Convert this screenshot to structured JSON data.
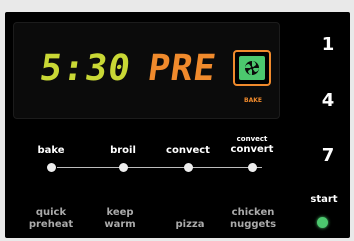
{
  "display": {
    "time": "5:30",
    "mode": "PRE",
    "indicator_label": "BAKE",
    "icon": "convection-fan-icon"
  },
  "keypad": {
    "k1": "1",
    "k4": "4",
    "k7": "7",
    "start_label": "start"
  },
  "modes": {
    "bake": "bake",
    "broil": "broil",
    "convect": "convect",
    "convect_convert_top": "convect",
    "convect_convert_bottom": "convert"
  },
  "options": {
    "quick_1": "quick",
    "quick_2": "preheat",
    "keep_1": "keep",
    "keep_2": "warm",
    "pizza": "pizza",
    "chicken_1": "chicken",
    "chicken_2": "nuggets"
  },
  "colors": {
    "time": "#c9d835",
    "mode": "#f08a2c",
    "icon_green": "#4cc86e",
    "start_led": "#4cc86e"
  }
}
